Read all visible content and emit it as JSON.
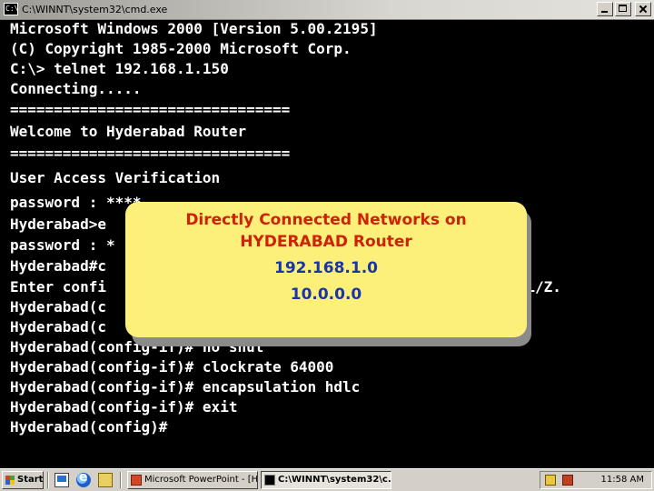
{
  "window": {
    "title": "C:\\WINNT\\system32\\cmd.exe",
    "icon_text": "C:\\"
  },
  "console": {
    "lines": [
      "Microsoft Windows 2000 [Version 5.00.2195]",
      "(C) Copyright 1985-2000 Microsoft Corp.",
      "C:\\> telnet 192.168.1.150",
      "Connecting.....",
      "================================",
      "Welcome to Hyderabad Router",
      "================================",
      "User Access Verification",
      "password : ****",
      "Hyderabad>e",
      "password : *",
      "Hyderabad#c",
      "Enter confi                                             CNTL/Z.",
      "Hyderabad(c",
      "Hyderabad(c",
      "Hyderabad(config-if)# no shut",
      "Hyderabad(config-if)# clockrate 64000",
      "Hyderabad(config-if)# encapsulation hdlc",
      "Hyderabad(config-if)# exit",
      "Hyderabad(config)#"
    ]
  },
  "popup": {
    "line1": "Directly Connected Networks on",
    "line2": "HYDERABAD Router",
    "network1": "192.168.1.0",
    "network2": "10.0.0.0"
  },
  "taskbar": {
    "start_label": "Start",
    "tasks": [
      {
        "label": "Microsoft PowerPoint - [H...",
        "icon": "powerpoint-icon"
      },
      {
        "label": "C:\\WINNT\\system32\\c...",
        "icon": "cmd-icon"
      }
    ],
    "clock": "11:58 AM"
  }
}
